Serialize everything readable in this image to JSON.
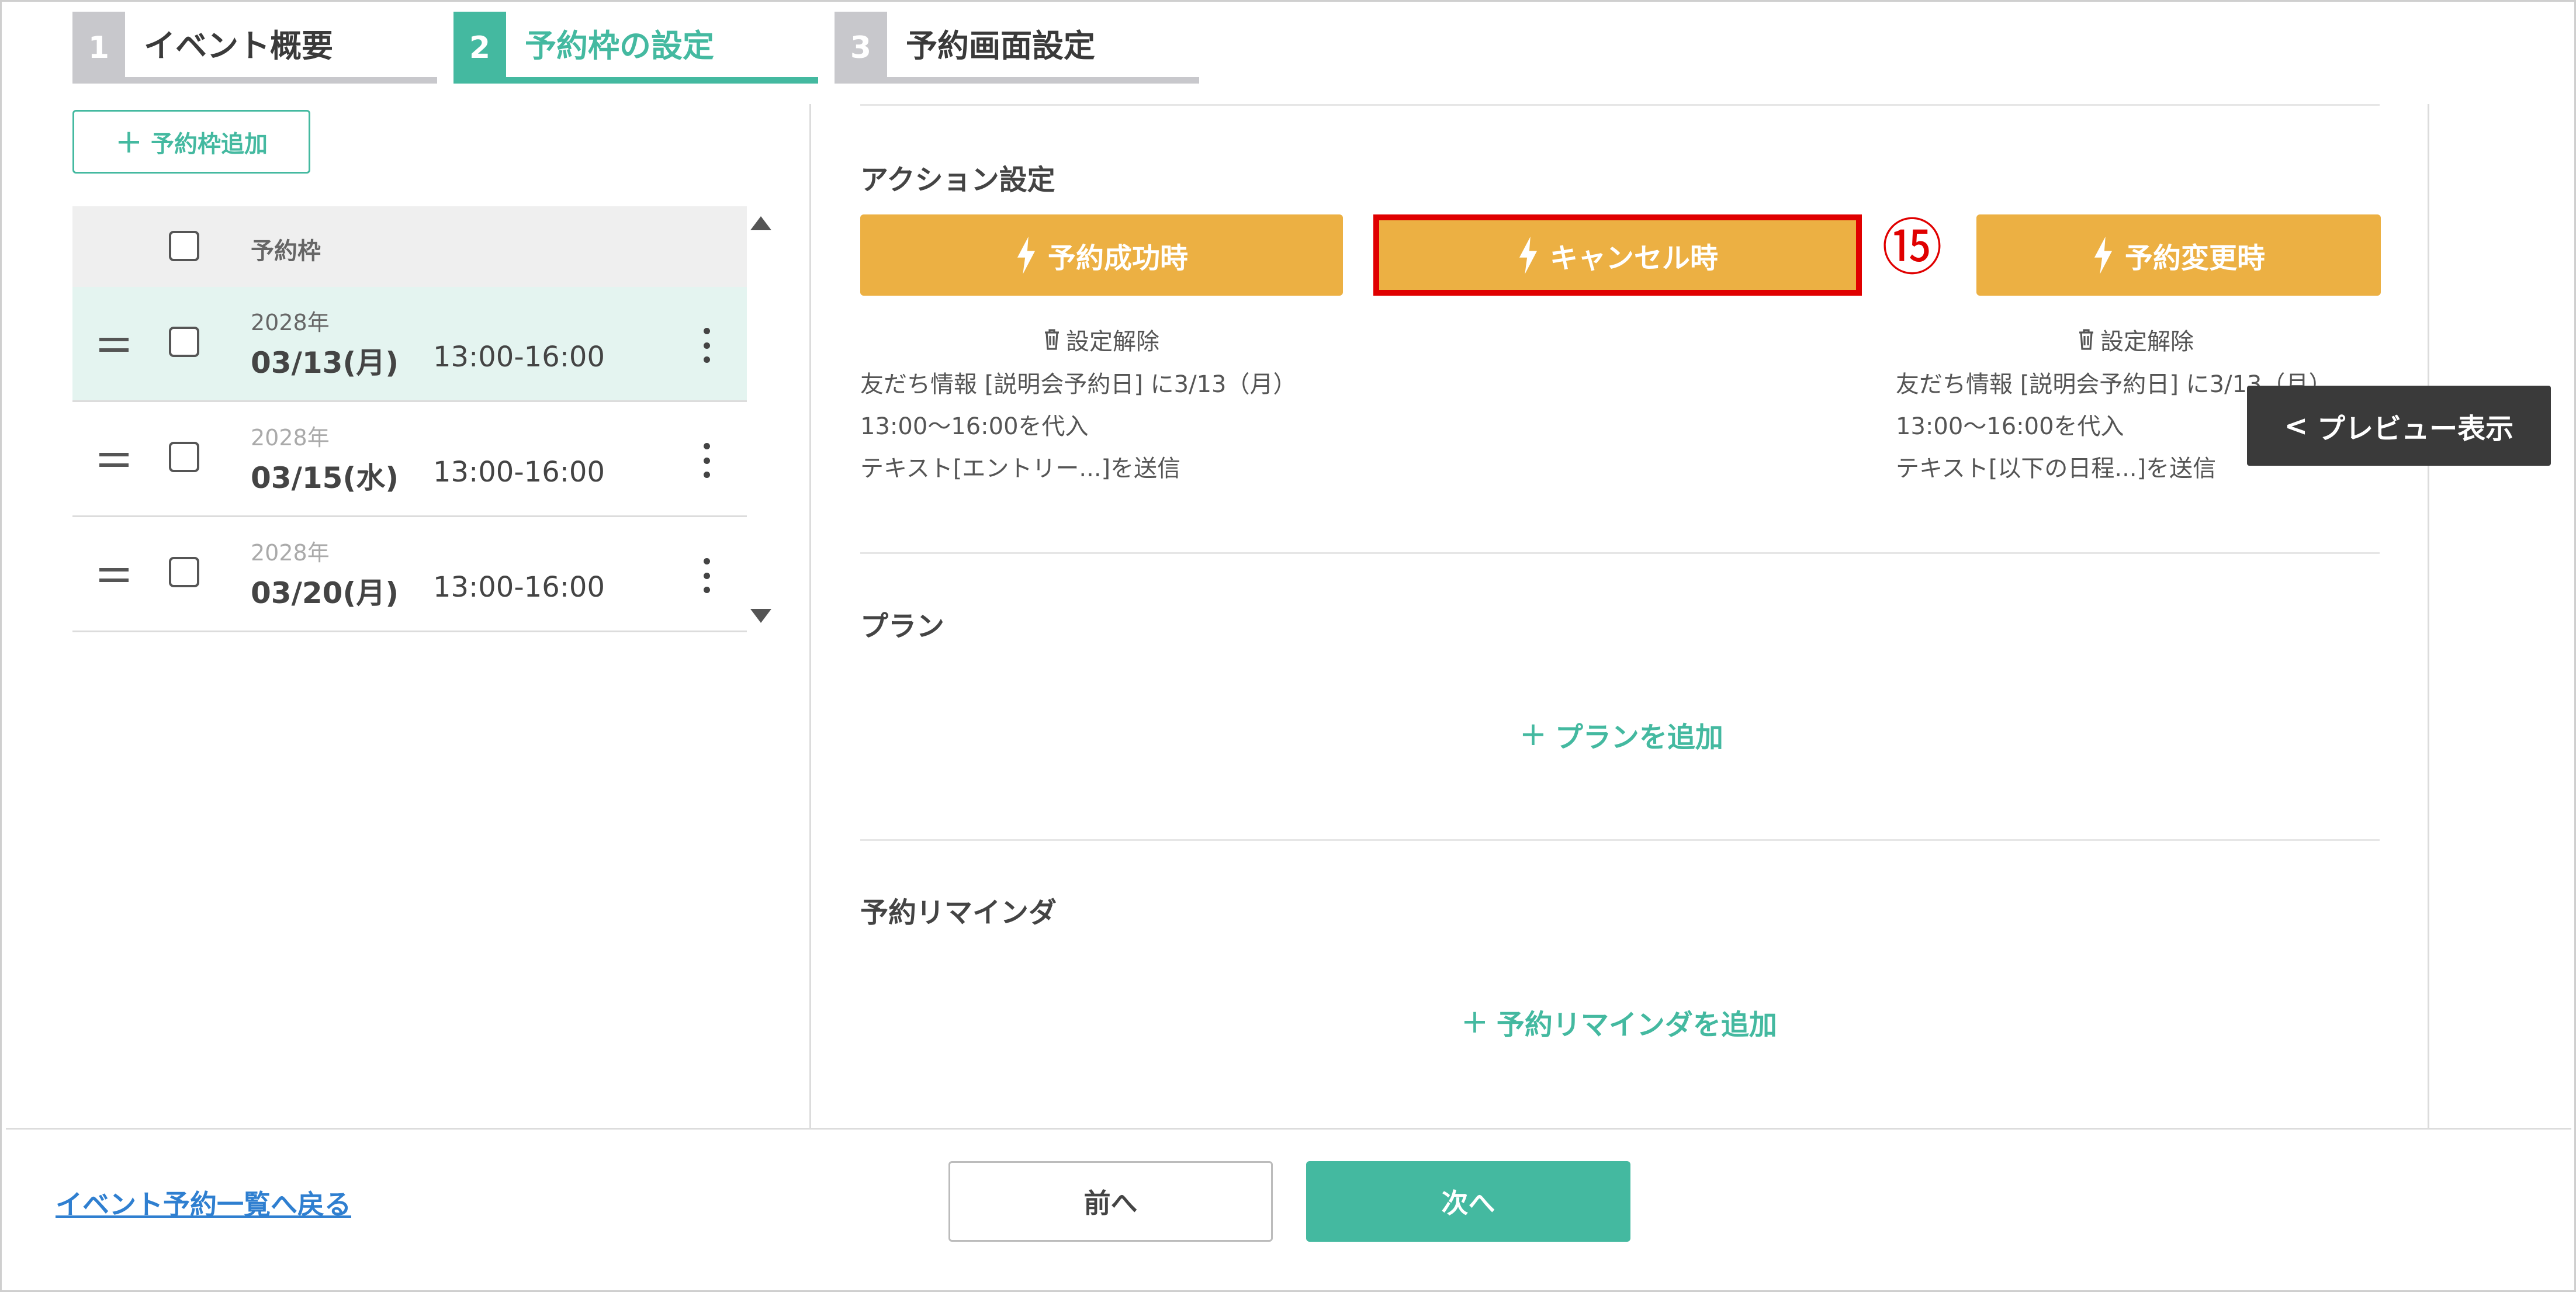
{
  "steps": [
    {
      "num": "1",
      "label": "イベント概要"
    },
    {
      "num": "2",
      "label": "予約枠の設定"
    },
    {
      "num": "3",
      "label": "予約画面設定"
    }
  ],
  "left": {
    "add_slot_label": "予約枠追加",
    "table_header": "予約枠",
    "rows": [
      {
        "year": "2028年",
        "date": "03/13(月)",
        "time": "13:00-16:00"
      },
      {
        "year": "2028年",
        "date": "03/15(水)",
        "time": "13:00-16:00"
      },
      {
        "year": "2028年",
        "date": "03/20(月)",
        "time": "13:00-16:00"
      }
    ]
  },
  "action": {
    "title": "アクション設定",
    "buttons": [
      "予約成功時",
      "キャンセル時",
      "予約変更時"
    ],
    "annotation": "⑮",
    "unset_label": "設定解除",
    "left_desc": [
      "友だち情報 [説明会予約日] に3/13（月）",
      "13:00〜16:00を代入",
      "テキスト[エントリー...]を送信"
    ],
    "right_desc": [
      "友だち情報 [説明会予約日] に3/13（月）",
      "13:00〜16:00を代入",
      "テキスト[以下の日程...]を送信"
    ]
  },
  "preview_label": "プレビュー表示",
  "plan": {
    "title": "プラン",
    "add_label": "プランを追加"
  },
  "reminder": {
    "title": "予約リマインダ",
    "add_label": "予約リマインダを追加"
  },
  "footer": {
    "back_link": "イベント予約一覧へ戻る",
    "prev": "前へ",
    "next": "次へ"
  },
  "colors": {
    "accent": "#44b9a0",
    "action_button": "#ecb043",
    "highlight": "#e00000",
    "link": "#2f7fd0"
  }
}
